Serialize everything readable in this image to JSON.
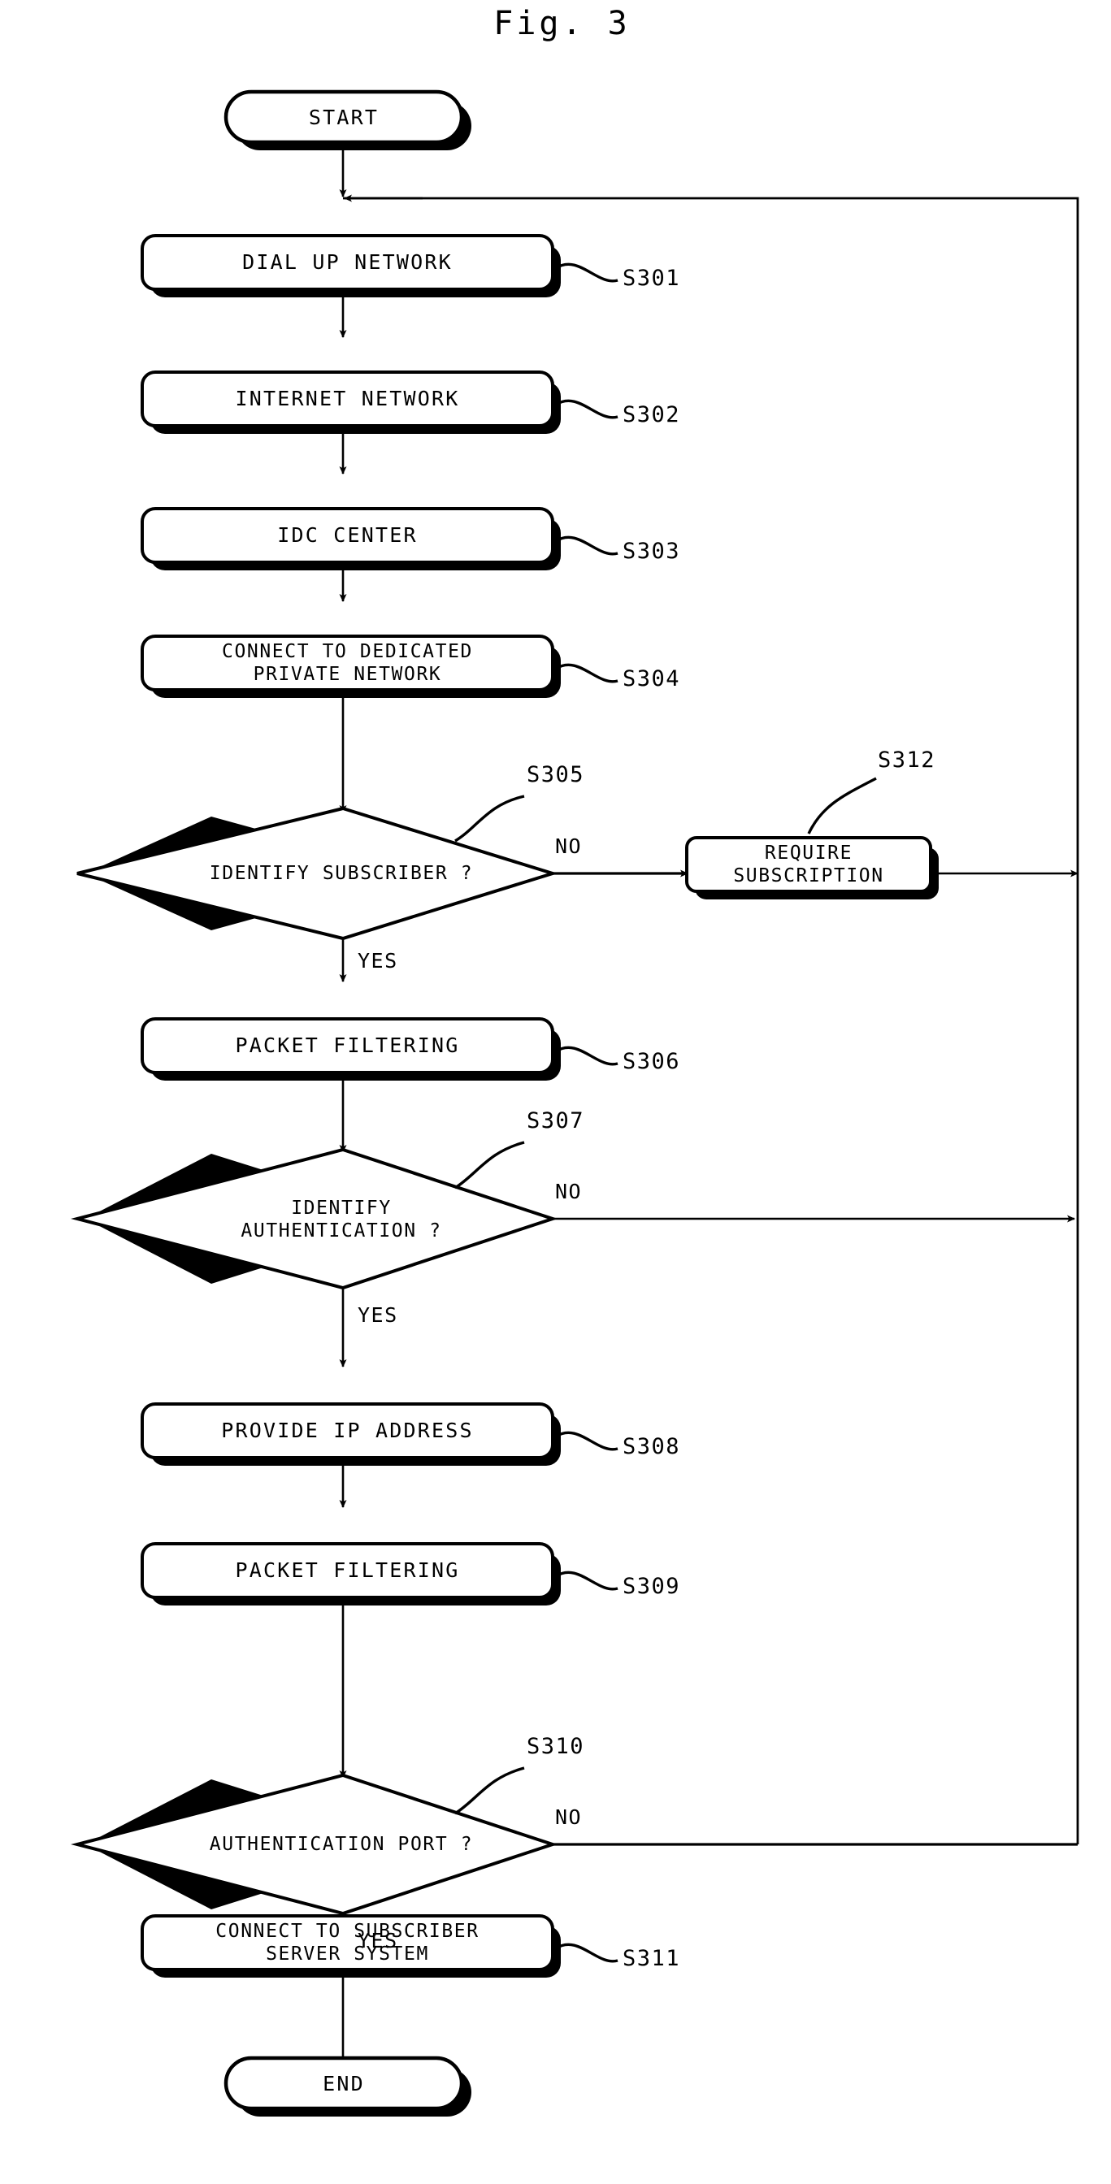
{
  "figure": {
    "title": "Fig. 3",
    "kind": "patent-flowchart"
  },
  "nodes": {
    "start": {
      "label": "START",
      "shape": "terminator"
    },
    "s301": {
      "label": "DIAL UP NETWORK",
      "shape": "process"
    },
    "s302": {
      "label": "INTERNET NETWORK",
      "shape": "process"
    },
    "s303": {
      "label": "IDC CENTER",
      "shape": "process"
    },
    "s304": {
      "label": "CONNECT TO DEDICATED\nPRIVATE NETWORK",
      "shape": "process"
    },
    "s305": {
      "label": "IDENTIFY SUBSCRIBER ?",
      "shape": "decision"
    },
    "s306": {
      "label": "PACKET FILTERING",
      "shape": "process"
    },
    "s307": {
      "label": "IDENTIFY\nAUTHENTICATION ?",
      "shape": "decision"
    },
    "s308": {
      "label": "PROVIDE IP ADDRESS",
      "shape": "process"
    },
    "s309": {
      "label": "PACKET FILTERING",
      "shape": "process"
    },
    "s310": {
      "label": "AUTHENTICATION PORT ?",
      "shape": "decision"
    },
    "s311": {
      "label": "CONNECT TO SUBSCRIBER\nSERVER SYSTEM",
      "shape": "process"
    },
    "s312": {
      "label": "REQUIRE\nSUBSCRIPTION",
      "shape": "process"
    },
    "end": {
      "label": "END",
      "shape": "terminator"
    }
  },
  "step_refs": {
    "s301": "S301",
    "s302": "S302",
    "s303": "S303",
    "s304": "S304",
    "s305": "S305",
    "s306": "S306",
    "s307": "S307",
    "s308": "S308",
    "s309": "S309",
    "s310": "S310",
    "s311": "S311",
    "s312": "S312"
  },
  "branch_labels": {
    "s305_no": "NO",
    "s305_yes": "YES",
    "s307_no": "NO",
    "s307_yes": "YES",
    "s310_no": "NO",
    "s310_yes": "YES"
  },
  "colors": {
    "ink": "#000000",
    "paper": "#ffffff"
  },
  "chart_data": {
    "type": "table",
    "title": "Fig. 3",
    "nodes": [
      {
        "id": "START",
        "text": "START",
        "shape": "terminator"
      },
      {
        "id": "S301",
        "text": "DIAL UP NETWORK",
        "shape": "process"
      },
      {
        "id": "S302",
        "text": "INTERNET NETWORK",
        "shape": "process"
      },
      {
        "id": "S303",
        "text": "IDC CENTER",
        "shape": "process"
      },
      {
        "id": "S304",
        "text": "CONNECT TO DEDICATED PRIVATE NETWORK",
        "shape": "process"
      },
      {
        "id": "S305",
        "text": "IDENTIFY SUBSCRIBER ?",
        "shape": "decision"
      },
      {
        "id": "S306",
        "text": "PACKET FILTERING",
        "shape": "process"
      },
      {
        "id": "S307",
        "text": "IDENTIFY AUTHENTICATION ?",
        "shape": "decision"
      },
      {
        "id": "S308",
        "text": "PROVIDE IP ADDRESS",
        "shape": "process"
      },
      {
        "id": "S309",
        "text": "PACKET FILTERING",
        "shape": "process"
      },
      {
        "id": "S310",
        "text": "AUTHENTICATION PORT ?",
        "shape": "decision"
      },
      {
        "id": "S311",
        "text": "CONNECT TO SUBSCRIBER SERVER SYSTEM",
        "shape": "process"
      },
      {
        "id": "S312",
        "text": "REQUIRE SUBSCRIPTION",
        "shape": "process"
      },
      {
        "id": "END",
        "text": "END",
        "shape": "terminator"
      }
    ],
    "edges": [
      {
        "from": "START",
        "to": "S301",
        "label": ""
      },
      {
        "from": "S301",
        "to": "S302",
        "label": ""
      },
      {
        "from": "S302",
        "to": "S303",
        "label": ""
      },
      {
        "from": "S303",
        "to": "S304",
        "label": ""
      },
      {
        "from": "S304",
        "to": "S305",
        "label": ""
      },
      {
        "from": "S305",
        "to": "S312",
        "label": "NO"
      },
      {
        "from": "S305",
        "to": "S306",
        "label": "YES"
      },
      {
        "from": "S312",
        "to": "S301",
        "label": ""
      },
      {
        "from": "S306",
        "to": "S307",
        "label": ""
      },
      {
        "from": "S307",
        "to": "S301",
        "label": "NO"
      },
      {
        "from": "S307",
        "to": "S308",
        "label": "YES"
      },
      {
        "from": "S308",
        "to": "S309",
        "label": ""
      },
      {
        "from": "S309",
        "to": "S310",
        "label": ""
      },
      {
        "from": "S310",
        "to": "S301",
        "label": "NO"
      },
      {
        "from": "S310",
        "to": "S311",
        "label": "YES"
      },
      {
        "from": "S311",
        "to": "END",
        "label": ""
      }
    ]
  }
}
